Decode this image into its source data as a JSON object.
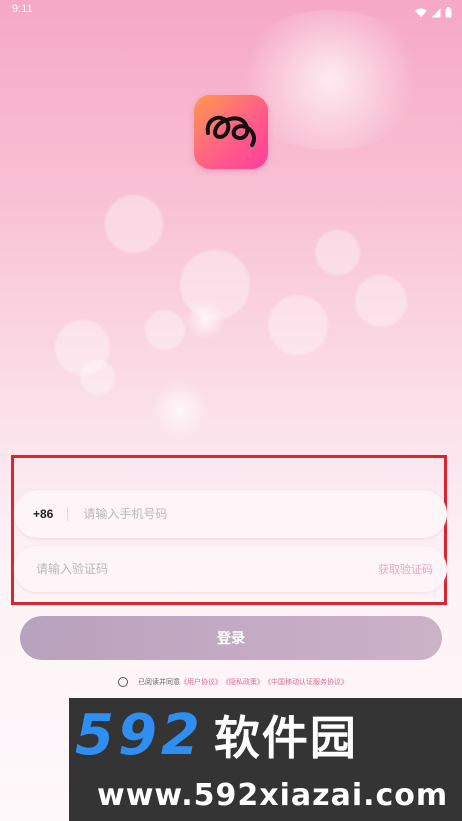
{
  "status_bar": {
    "time": "9:11"
  },
  "app": {
    "logo_icon": "scribble-swirl-logo-icon"
  },
  "login_form": {
    "country_code": "+86",
    "phone_placeholder": "请输入手机号码",
    "code_placeholder": "请输入验证码",
    "get_code_label": "获取验证码",
    "login_label": "登录"
  },
  "agreement": {
    "prefix": "已阅读并同意",
    "user_agreement": "《用户协议》",
    "privacy_policy": "《隐私政策》",
    "cmcc_agreement": "《中国移动认证服务协议》"
  },
  "watermark": {
    "brand_number": "592",
    "brand_name": "软件园",
    "url": "www.592xiazai.com"
  },
  "colors": {
    "highlight_border": "#d8262a",
    "get_code_text": "#f4a3b9",
    "login_button": "#c3aac3",
    "watermark_blue": "#2f8ef2"
  }
}
